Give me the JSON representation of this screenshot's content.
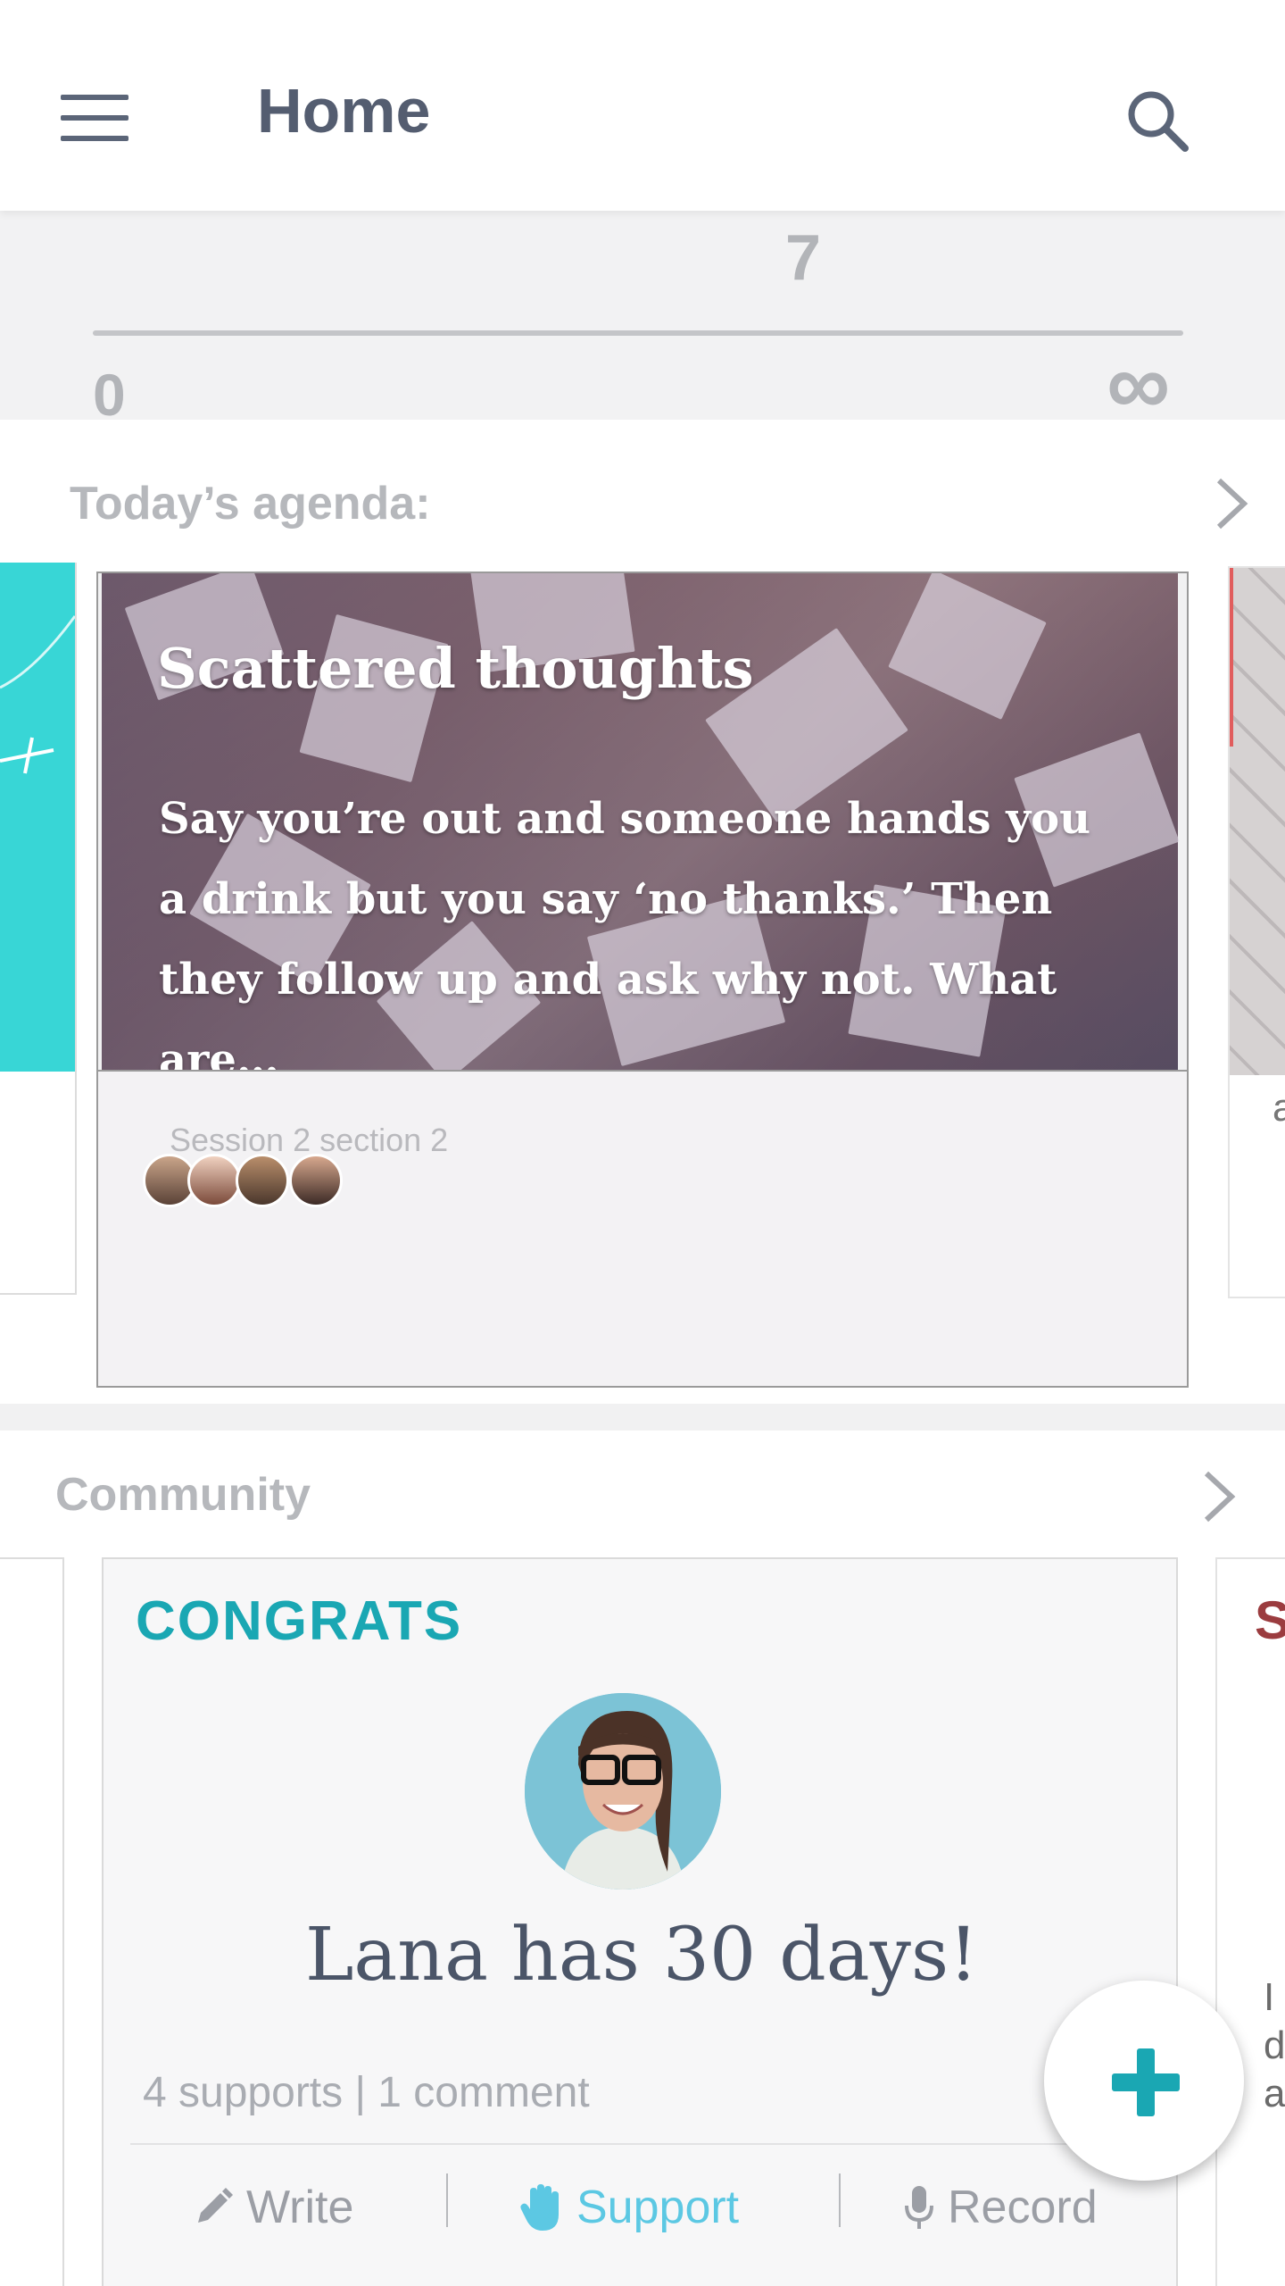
{
  "header": {
    "title": "Home",
    "menu_icon": "hamburger-menu-icon",
    "search_icon": "search-icon"
  },
  "progress": {
    "current": "7",
    "min": "0",
    "max": "∞"
  },
  "agenda": {
    "heading": "Today’s agenda:",
    "card": {
      "title": "Scattered thoughts",
      "body": "Say you’re out and someone hands you a drink but you say ‘no thanks.’ Then they follow up and ask why not. What are…",
      "session": "Session 2 section 2",
      "participant_count": 4
    },
    "peek_right_text": "a"
  },
  "community": {
    "heading": "Community",
    "card": {
      "label": "CONGRATS",
      "headline": "Lana has 30 days!",
      "stats": "4 supports | 1 comment",
      "actions": {
        "write": "Write",
        "support": "Support",
        "record": "Record"
      }
    },
    "peek_right": {
      "label": "S",
      "text": "I\nd\na"
    }
  },
  "fab": {
    "icon": "plus-icon"
  },
  "colors": {
    "accent_teal": "#1aa7b3",
    "support_blue": "#5cc8e3",
    "text_dark": "#4b5568",
    "muted": "#b6b8bc"
  }
}
